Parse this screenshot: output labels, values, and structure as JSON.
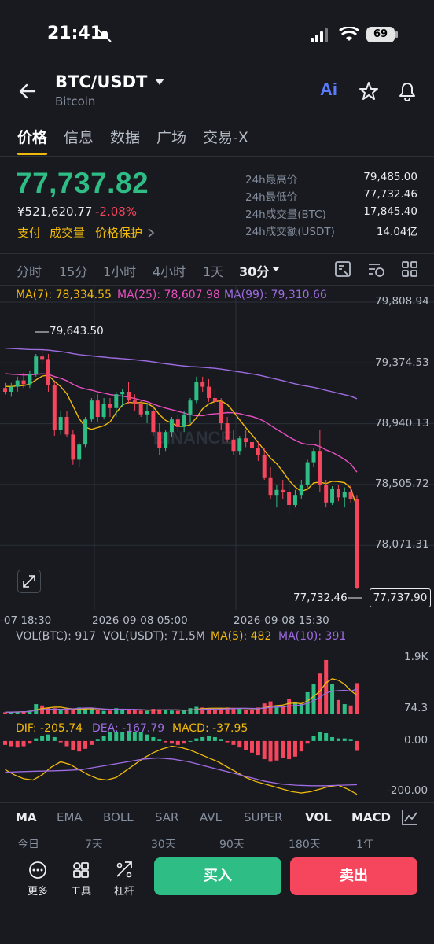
{
  "status_bar": {
    "time": "21:41",
    "battery": "69"
  },
  "header": {
    "pair": "BTC/USDT",
    "name": "Bitcoin",
    "ai_label": "Ai"
  },
  "tabs": [
    "价格",
    "信息",
    "数据",
    "广场",
    "交易-X"
  ],
  "price": {
    "last": "77,737.82",
    "cny": "¥521,620.77",
    "change": "-2.08%",
    "links": [
      "支付",
      "成交量",
      "价格保护"
    ]
  },
  "stats": [
    {
      "label": "24h最高价",
      "value": "79,485.00"
    },
    {
      "label": "24h最低价",
      "value": "77,732.46"
    },
    {
      "label": "24h成交量(BTC)",
      "value": "17,845.40"
    },
    {
      "label": "24h成交额(USDT)",
      "value": "14.04亿"
    }
  ],
  "intervals": [
    "分时",
    "15分",
    "1小时",
    "4小时",
    "1天",
    "30分"
  ],
  "ma_legend": {
    "ma7": "MA(7): 78,334.55",
    "ma25": "MA(25): 78,607.98",
    "ma99": "MA(99): 79,310.66"
  },
  "price_axis": [
    "79,808.94",
    "79,374.53",
    "78,940.13",
    "78,505.72",
    "78,071.31"
  ],
  "chart_labels": {
    "high_marker": "79,643.50",
    "low_marker": "77,732.46",
    "current_price": "77,737.90",
    "watermark": "BINANCE"
  },
  "time_axis": [
    "-07 18:30",
    "2026-09-08 05:00",
    "2026-09-08 15:30"
  ],
  "vol_legend": {
    "btc": "VOL(BTC): 917",
    "usdt": "VOL(USDT): 71.5M",
    "ma5": "MA(5): 482",
    "ma10": "MA(10): 391"
  },
  "vol_axis": [
    "1.9K",
    "74.3"
  ],
  "macd_legend": {
    "dif": "DIF: -205.74",
    "dea": "DEA: -167.79",
    "macd": "MACD: -37.95"
  },
  "macd_axis": [
    "0.00",
    "-200.00"
  ],
  "indicator_tabs": [
    "MA",
    "EMA",
    "BOLL",
    "SAR",
    "AVL",
    "SUPER",
    "VOL",
    "MACD"
  ],
  "periods": [
    "今日",
    "7天",
    "30天",
    "90天",
    "180天",
    "1年"
  ],
  "bottom_bar": {
    "more": "更多",
    "tools": "工具",
    "leverage": "杠杆",
    "buy": "买入",
    "sell": "卖出"
  },
  "colors": {
    "up": "#2ebd85",
    "down": "#f6465d",
    "accent": "#f0b90b",
    "ma7": "#f0b90b",
    "ma25": "#e84fc0",
    "ma99": "#9e6be0"
  },
  "chart_data": {
    "type": "candlestick",
    "interval": "30分",
    "ylim": [
      77650,
      79900
    ],
    "ohlc": [
      [
        79330,
        79370,
        79280,
        79300
      ],
      [
        79300,
        79370,
        79260,
        79340
      ],
      [
        79340,
        79420,
        79300,
        79390
      ],
      [
        79390,
        79450,
        79330,
        79360
      ],
      [
        79360,
        79470,
        79330,
        79440
      ],
      [
        79440,
        79600,
        79420,
        79580
      ],
      [
        79580,
        79643,
        79520,
        79560
      ],
      [
        79560,
        79600,
        79300,
        79350
      ],
      [
        79350,
        79380,
        78950,
        79000
      ],
      [
        79000,
        79150,
        78960,
        79100
      ],
      [
        79100,
        79150,
        78940,
        78960
      ],
      [
        78960,
        79000,
        78720,
        78760
      ],
      [
        78760,
        78900,
        78700,
        78880
      ],
      [
        78880,
        79100,
        78860,
        79080
      ],
      [
        79080,
        79250,
        79060,
        79230
      ],
      [
        79230,
        79280,
        79060,
        79100
      ],
      [
        79100,
        79250,
        79080,
        79200
      ],
      [
        79200,
        79250,
        79100,
        79170
      ],
      [
        79170,
        79300,
        79100,
        79280
      ],
      [
        79280,
        79320,
        79180,
        79300
      ],
      [
        79300,
        79380,
        79200,
        79230
      ],
      [
        79230,
        79280,
        79150,
        79200
      ],
      [
        79200,
        79230,
        79100,
        79120
      ],
      [
        79120,
        79200,
        79050,
        79150
      ],
      [
        79150,
        79200,
        78950,
        78980
      ],
      [
        78980,
        79050,
        78800,
        78850
      ],
      [
        78850,
        79000,
        78830,
        78980
      ],
      [
        78980,
        79100,
        78940,
        79080
      ],
      [
        79080,
        79120,
        78980,
        79020
      ],
      [
        79020,
        79150,
        78980,
        79120
      ],
      [
        79120,
        79250,
        79050,
        79230
      ],
      [
        79230,
        79420,
        79210,
        79380
      ],
      [
        79380,
        79420,
        79300,
        79340
      ],
      [
        79340,
        79400,
        79220,
        79250
      ],
      [
        79250,
        79320,
        79180,
        79220
      ],
      [
        79220,
        79250,
        79000,
        79050
      ],
      [
        79050,
        79100,
        78900,
        78920
      ],
      [
        78920,
        79000,
        78800,
        78830
      ],
      [
        78830,
        78950,
        78800,
        78930
      ],
      [
        78930,
        79000,
        78860,
        78900
      ],
      [
        78900,
        78960,
        78820,
        78850
      ],
      [
        78850,
        78900,
        78750,
        78800
      ],
      [
        78800,
        78850,
        78600,
        78620
      ],
      [
        78620,
        78700,
        78450,
        78480
      ],
      [
        78480,
        78560,
        78380,
        78520
      ],
      [
        78520,
        78600,
        78450,
        78500
      ],
      [
        78500,
        78580,
        78330,
        78400
      ],
      [
        78400,
        78520,
        78380,
        78480
      ],
      [
        78480,
        78600,
        78450,
        78560
      ],
      [
        78560,
        78760,
        78540,
        78740
      ],
      [
        78740,
        78850,
        78700,
        78830
      ],
      [
        78830,
        79000,
        78500,
        78560
      ],
      [
        78560,
        78600,
        78380,
        78420
      ],
      [
        78420,
        78550,
        78400,
        78530
      ],
      [
        78530,
        78560,
        78430,
        78460
      ],
      [
        78460,
        78540,
        78380,
        78500
      ],
      [
        78500,
        78560,
        78420,
        78450
      ],
      [
        78450,
        78480,
        77732,
        77738
      ]
    ],
    "volume": [
      60,
      70,
      80,
      90,
      110,
      300,
      260,
      200,
      180,
      120,
      140,
      150,
      200,
      180,
      160,
      120,
      100,
      110,
      180,
      150,
      130,
      120,
      110,
      100,
      160,
      150,
      130,
      110,
      100,
      120,
      180,
      220,
      200,
      160,
      140,
      180,
      200,
      190,
      160,
      130,
      140,
      200,
      320,
      380,
      240,
      220,
      450,
      360,
      300,
      650,
      880,
      1200,
      1600,
      900,
      420,
      300,
      260,
      917
    ],
    "macd_hist": [
      -15,
      -20,
      -25,
      -20,
      -10,
      10,
      20,
      25,
      15,
      -5,
      -20,
      -35,
      -40,
      -30,
      -15,
      5,
      20,
      40,
      55,
      60,
      55,
      45,
      35,
      25,
      15,
      5,
      -5,
      -10,
      -15,
      -10,
      0,
      10,
      15,
      20,
      15,
      5,
      -5,
      -15,
      -25,
      -35,
      -45,
      -55,
      -70,
      -80,
      -75,
      -65,
      -70,
      -60,
      -40,
      -10,
      20,
      40,
      30,
      15,
      10,
      10,
      5,
      -38
    ],
    "dif": [
      -110,
      -130,
      -145,
      -150,
      -130,
      -100,
      -80,
      -90,
      -110,
      -130,
      -145,
      -150,
      -140,
      -115,
      -90,
      -65,
      -45,
      -30,
      -20,
      -25,
      -35,
      -50,
      -65,
      -80,
      -100,
      -120,
      -140,
      -155,
      -165,
      -175,
      -185,
      -195,
      -200,
      -195,
      -185,
      -175,
      -170,
      -185,
      -205
    ],
    "dea": [
      -120,
      -118,
      -116,
      -115,
      -113,
      -110,
      -100,
      -90,
      -80,
      -70,
      -65,
      -70,
      -80,
      -95,
      -110,
      -125,
      -140,
      -155,
      -165,
      -170,
      -172,
      -172,
      -170,
      -168
    ],
    "macd_ylim": [
      -230,
      30
    ]
  }
}
